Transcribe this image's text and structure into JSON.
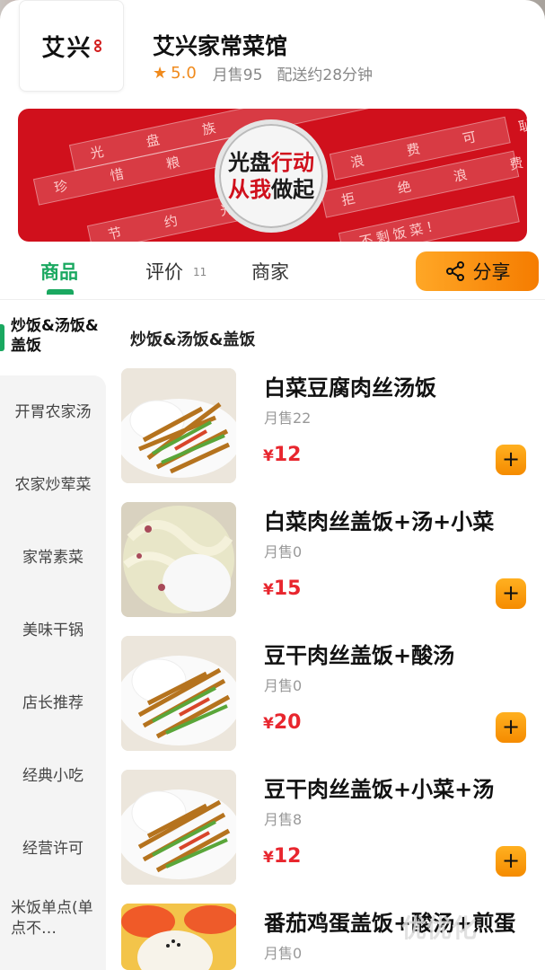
{
  "store": {
    "logo_text": "艾兴",
    "name": "艾兴家常菜馆",
    "rating": "5.0",
    "monthly_sales": "月售95",
    "delivery_time": "配送约28分钟"
  },
  "banner": {
    "plate_line1_black": "光盘",
    "plate_line1_red": "行动",
    "plate_line2_red": "从我",
    "plate_line2_black": "做起",
    "bands": [
      "光 盘 族",
      "珍 惜 粮 食",
      "节 约 光 荣",
      "浪 费 可 耻",
      "拒 绝 浪 费",
      "不剩饭菜！"
    ]
  },
  "tabs": {
    "goods": "商品",
    "reviews": "评价",
    "reviews_count": "11",
    "merchant": "商家",
    "share": "分享"
  },
  "categories": {
    "active": "炒饭&汤饭&盖饭",
    "items": [
      "开胃农家汤",
      "农家炒荤菜",
      "家常素菜",
      "美味干锅",
      "店长推荐",
      "经典小吃",
      "经营许可",
      "米饭单点(单点不…"
    ]
  },
  "section_title": "炒饭&汤饭&盖饭",
  "products": [
    {
      "name": "白菜豆腐肉丝汤饭",
      "sales": "月售22",
      "price": "12"
    },
    {
      "name": "白菜肉丝盖饭+汤+小菜",
      "sales": "月售0",
      "price": "15"
    },
    {
      "name": "豆干肉丝盖饭+酸汤",
      "sales": "月售0",
      "price": "20"
    },
    {
      "name": "豆干肉丝盖饭+小菜+汤",
      "sales": "月售8",
      "price": "12"
    },
    {
      "name": "番茄鸡蛋盖饭+酸汤+煎蛋",
      "sales": "月售0",
      "price": ""
    }
  ],
  "currency": "¥",
  "add_label": "+",
  "watermark": "优优化",
  "colors": {
    "accent_green": "#1aa860",
    "price_red": "#e8262e",
    "orange": "#f58b00",
    "banner_red": "#d0101c"
  }
}
